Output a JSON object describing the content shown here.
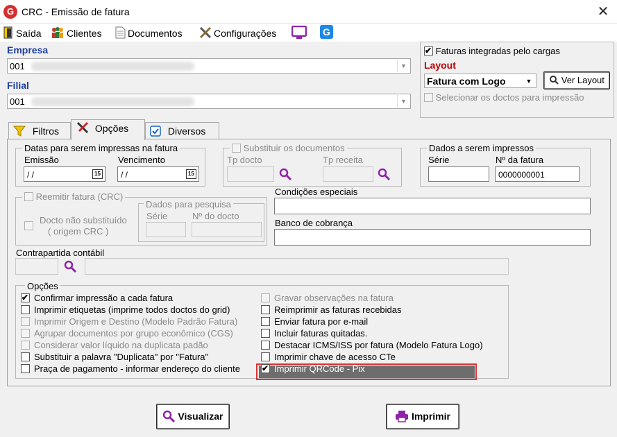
{
  "window": {
    "title": "CRC - Emissão de fatura",
    "app_icon": "G",
    "close": "✕"
  },
  "menu": [
    {
      "label": "Saída",
      "icon": "exit-door-icon"
    },
    {
      "label": "Clientes",
      "icon": "people-icon"
    },
    {
      "label": "Documentos",
      "icon": "document-icon"
    },
    {
      "label": "Configurações",
      "icon": "tools-icon"
    }
  ],
  "empresa": {
    "label": "Empresa",
    "value": "001"
  },
  "filial": {
    "label": "Filial",
    "value": "001"
  },
  "faturas_integradas": "Faturas integradas pelo cargas",
  "layout": {
    "label": "Layout",
    "value": "Fatura com Logo",
    "ver_layout": "Ver Layout"
  },
  "selecionar_doctos": "Selecionar os doctos para impressão",
  "tabs": [
    "Filtros",
    "Opções",
    "Diversos"
  ],
  "datas": {
    "legend": "Datas para serem impressas na fatura",
    "emissao_label": "Emissão",
    "emissao_value": " / /",
    "vencimento_label": "Vencimento",
    "vencimento_value": " / /",
    "cal": "15"
  },
  "substituir": {
    "legend": "Substituir os documentos",
    "tp_docto": "Tp docto",
    "tp_receita": "Tp receita"
  },
  "dados_impressos": {
    "legend": "Dados a serem impressos",
    "serie_label": "Série",
    "nfatura_label": "Nº da fatura",
    "nfatura_value": "0000000001"
  },
  "reemitir": {
    "legend": "Reemitir fatura (CRC)",
    "docto_nao_subst": "Docto não substituído",
    "origem": "( origem CRC )"
  },
  "dados_pesquisa": {
    "legend": "Dados para pesquisa",
    "serie": "Série",
    "ndocto": "Nº do docto"
  },
  "condicoes_label": "Condições especiais",
  "banco_label": "Banco de cobrança",
  "contrapartida_label": "Contrapartida contábil",
  "opcoes": {
    "legend": "Opções",
    "left": [
      {
        "label": "Confirmar impressão a cada fatura",
        "checked": true,
        "enabled": true
      },
      {
        "label": "Imprimir etiquetas (imprime todos doctos do grid)",
        "checked": false,
        "enabled": true
      },
      {
        "label": "Imprimir Origem e Destino (Modelo Padrão Fatura)",
        "checked": false,
        "enabled": false
      },
      {
        "label": "Agrupar documentos por grupo econômico (CGS)",
        "checked": false,
        "enabled": false
      },
      {
        "label": "Considerar valor líquido na duplicata padão",
        "checked": false,
        "enabled": false
      },
      {
        "label": "Substituir a palavra \"Duplicata\" por \"Fatura\"",
        "checked": false,
        "enabled": true
      },
      {
        "label": "Praça de pagamento - informar endereço do cliente",
        "checked": false,
        "enabled": true
      }
    ],
    "right": [
      {
        "label": "Gravar observações na fatura",
        "checked": false,
        "enabled": false
      },
      {
        "label": "Reimprimir as faturas recebidas",
        "checked": false,
        "enabled": true
      },
      {
        "label": "Enviar fatura por e-mail",
        "checked": false,
        "enabled": true
      },
      {
        "label": "Incluir faturas quitadas.",
        "checked": false,
        "enabled": true
      },
      {
        "label": "Destacar ICMS/ISS por fatura (Modelo Fatura Logo)",
        "checked": false,
        "enabled": true
      },
      {
        "label": "Imprimir chave de acesso CTe",
        "checked": false,
        "enabled": true
      },
      {
        "label": "Imprimir QRCode - Pix",
        "checked": true,
        "enabled": true,
        "highlighted": true
      }
    ]
  },
  "buttons": {
    "visualizar": "Visualizar",
    "imprimir": "Imprimir"
  },
  "colors": {
    "highlight_border": "#dd3333",
    "label_blue": "#1f3f9f",
    "label_red": "#c00000"
  }
}
